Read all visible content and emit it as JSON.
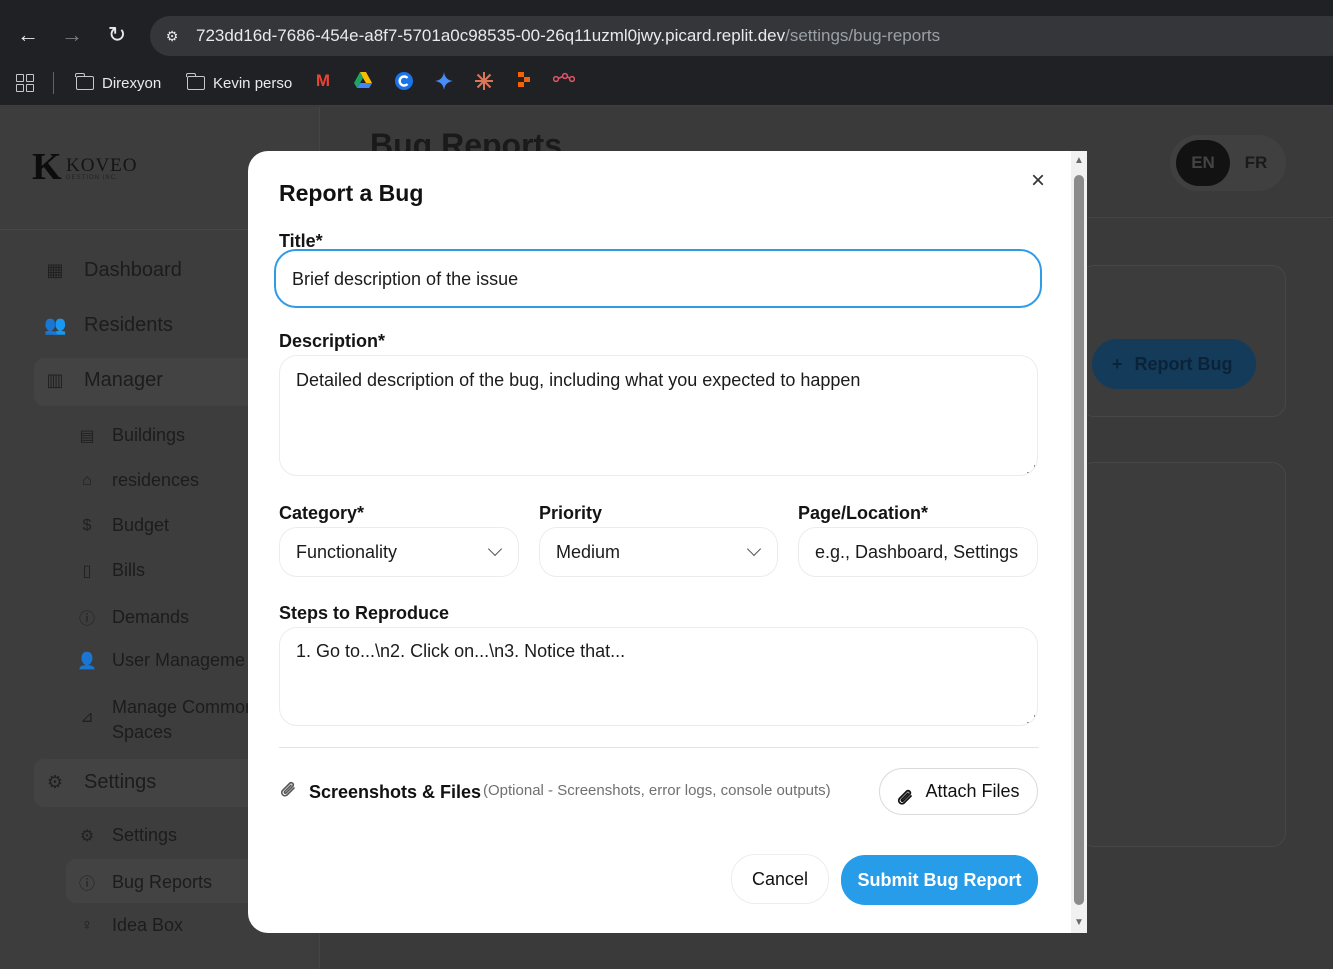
{
  "browser": {
    "url_host": "723dd16d-7686-454e-a8f7-5701a0c98535-00-26q11uzml0jwy.picard.replit.dev",
    "url_path": "/settings/bug-reports",
    "bookmarks": [
      {
        "label": "Direxyon"
      },
      {
        "label": "Kevin perso"
      }
    ]
  },
  "app": {
    "logo_word": "KOVEO",
    "logo_sub": "GESTION INC.",
    "page_title": "Bug Reports",
    "lang_en": "EN",
    "lang_fr": "FR",
    "report_bug_label": "Report Bug",
    "sidebar": {
      "dashboard": "Dashboard",
      "residents": "Residents",
      "manager": "Manager",
      "buildings": "Buildings",
      "residences": "residences",
      "budget": "Budget",
      "bills": "Bills",
      "demands": "Demands",
      "user_management": "User Manageme",
      "manage_common_1": "Manage Commor",
      "manage_common_2": "Spaces",
      "settings_section": "Settings",
      "settings": "Settings",
      "bug_reports": "Bug Reports",
      "idea_box": "Idea Box"
    }
  },
  "modal": {
    "title": "Report a Bug",
    "title_label": "Title*",
    "title_placeholder": "Brief description of the issue",
    "description_label": "Description*",
    "description_placeholder": "Detailed description of the bug, including what you expected to happen",
    "category_label": "Category*",
    "category_value": "Functionality",
    "priority_label": "Priority",
    "priority_value": "Medium",
    "page_label": "Page/Location*",
    "page_placeholder": "e.g., Dashboard, Settings",
    "steps_label": "Steps to Reproduce",
    "steps_placeholder": "1. Go to...\\n2. Click on...\\n3. Notice that...",
    "files_label": "Screenshots & Files",
    "files_hint": "(Optional - Screenshots, error logs, console outputs)",
    "attach_label": "Attach Files",
    "cancel_label": "Cancel",
    "submit_label": "Submit Bug Report"
  },
  "colors": {
    "accent": "#279ce8",
    "focus_border": "#2f9be8"
  }
}
